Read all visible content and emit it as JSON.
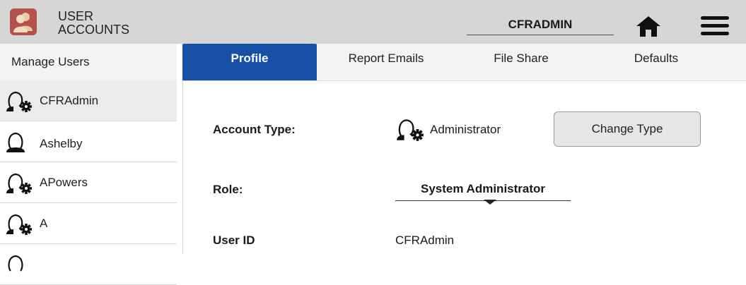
{
  "header": {
    "app_title_line1": "USER",
    "app_title_line2": "ACCOUNTS",
    "current_user": "CFRADMIN",
    "app_icon": "user-accounts-icon",
    "home_icon": "home-icon",
    "menu_icon": "hamburger-menu-icon",
    "brand_color": "#b5524b"
  },
  "sidebar": {
    "title": "Manage Users",
    "users": [
      {
        "name": "CFRAdmin",
        "icon": "admin-user-icon",
        "selected": true
      },
      {
        "name": "Ashelby",
        "icon": "user-icon",
        "selected": false
      },
      {
        "name": "APowers",
        "icon": "admin-user-icon",
        "selected": false
      },
      {
        "name": "A",
        "icon": "admin-user-icon",
        "selected": false
      }
    ]
  },
  "tabs": [
    {
      "label": "Profile",
      "active": true
    },
    {
      "label": "Report Emails",
      "active": false
    },
    {
      "label": "File Share",
      "active": false
    },
    {
      "label": "Defaults",
      "active": false
    }
  ],
  "accent_color": "#1750a6",
  "profile": {
    "account_type_label": "Account Type:",
    "account_type_value": "Administrator",
    "account_type_icon": "admin-user-icon",
    "change_type_button": "Change Type",
    "role_label": "Role:",
    "role_value": "System Administrator",
    "user_id_label": "User ID",
    "user_id_value": "CFRAdmin"
  }
}
